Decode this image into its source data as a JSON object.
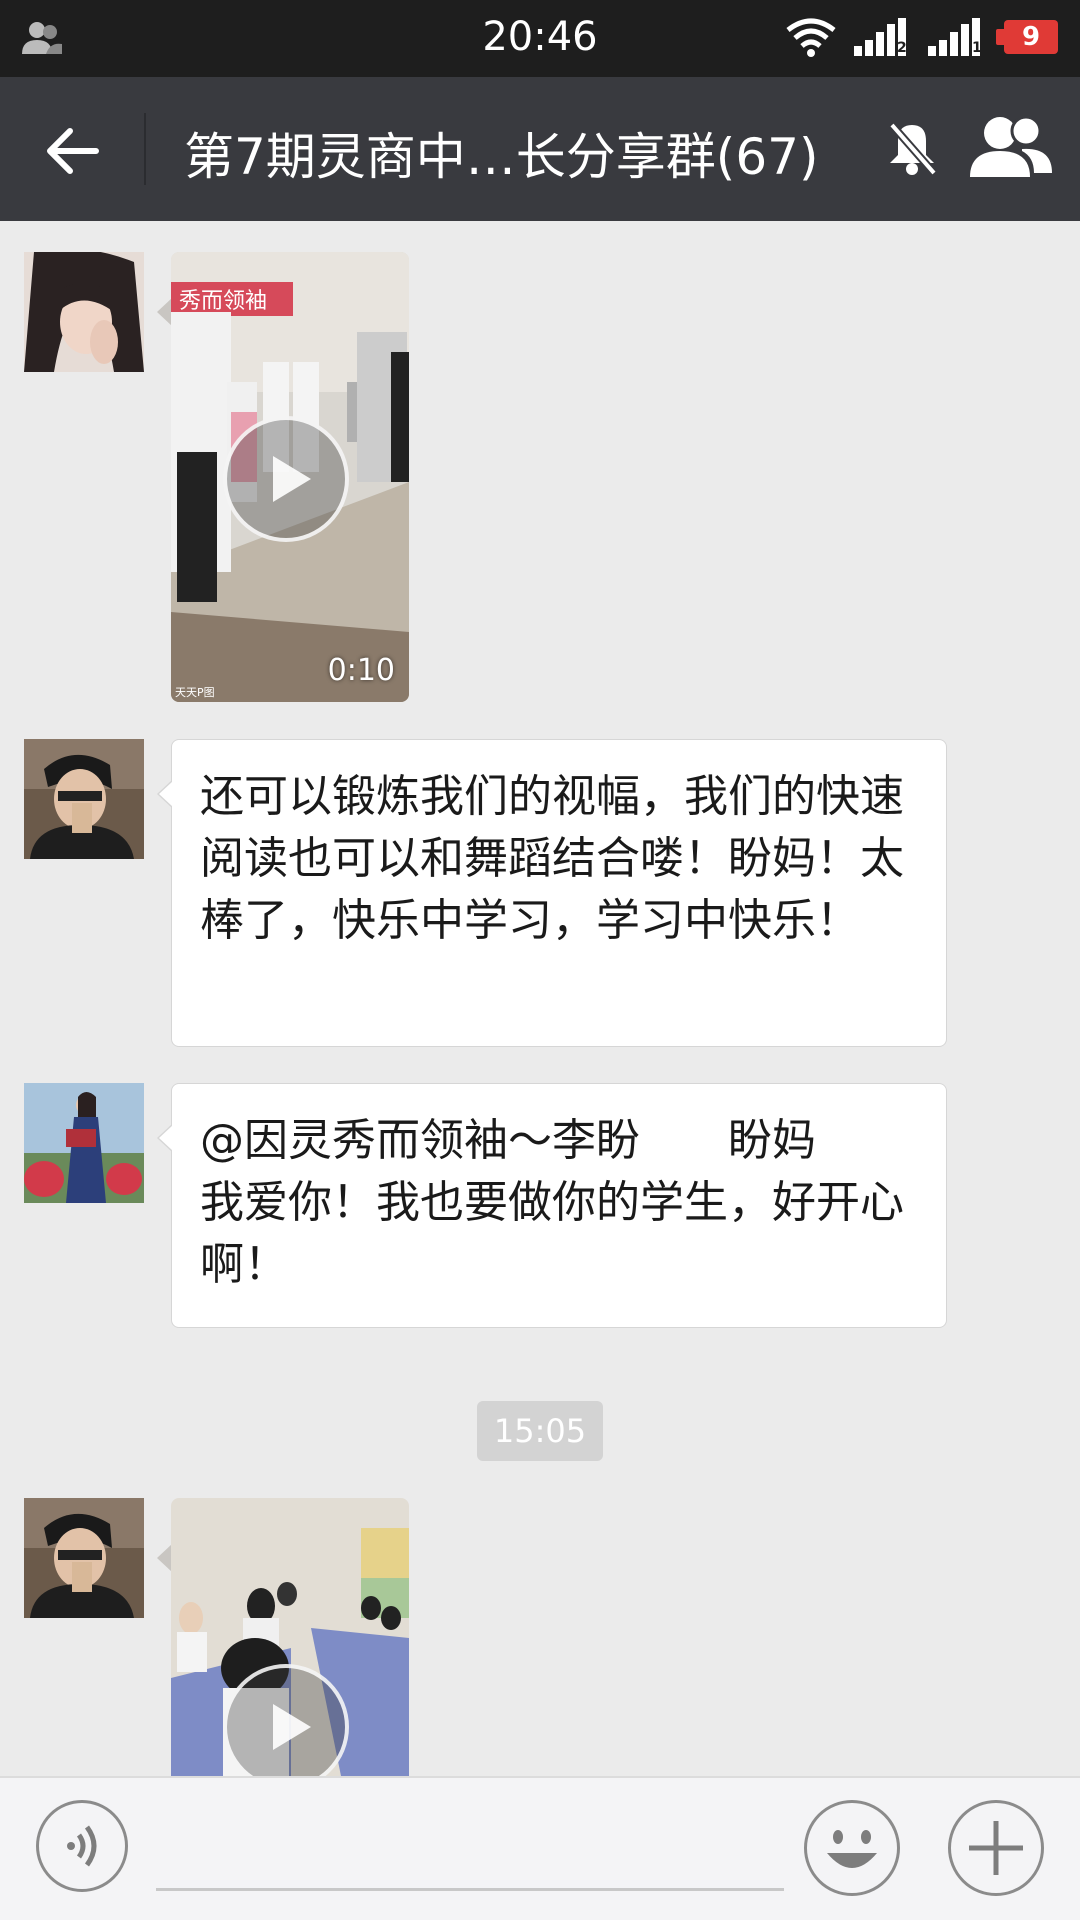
{
  "status_bar": {
    "time": "20:46",
    "battery": "9",
    "sim1": "2",
    "sim2": "1",
    "icons": [
      "user-icon",
      "wifi-icon",
      "signal-icon",
      "signal-icon",
      "battery-icon"
    ]
  },
  "header": {
    "title": "第7期灵商中…长分享群(67)",
    "icons": [
      "back-arrow-icon",
      "mute-bell-icon",
      "group-members-icon"
    ]
  },
  "messages": [
    {
      "type": "video",
      "duration": "0:10",
      "banner": "秀而领袖",
      "watermark": "天天P图"
    },
    {
      "type": "text",
      "text": "还可以锻炼我们的视幅，我们的快速阅读也可以和舞蹈结合喽！盼妈！太棒了，快乐中学习，学习中快乐！"
    },
    {
      "type": "text",
      "text": "@因灵秀而领袖～李盼　　盼妈\n我爱你！我也要做你的学生，好开心啊！"
    },
    {
      "type": "timestamp",
      "text": "15:05"
    },
    {
      "type": "video"
    }
  ],
  "input_bar": {
    "placeholder": "",
    "icons": [
      "voice-icon",
      "emoji-icon",
      "plus-icon"
    ]
  },
  "colors": {
    "status_bar": "#1e1e1e",
    "title_bar": "#393a3f",
    "chat_bg": "#ebebeb",
    "bubble": "#ffffff",
    "battery": "#e03a36"
  }
}
